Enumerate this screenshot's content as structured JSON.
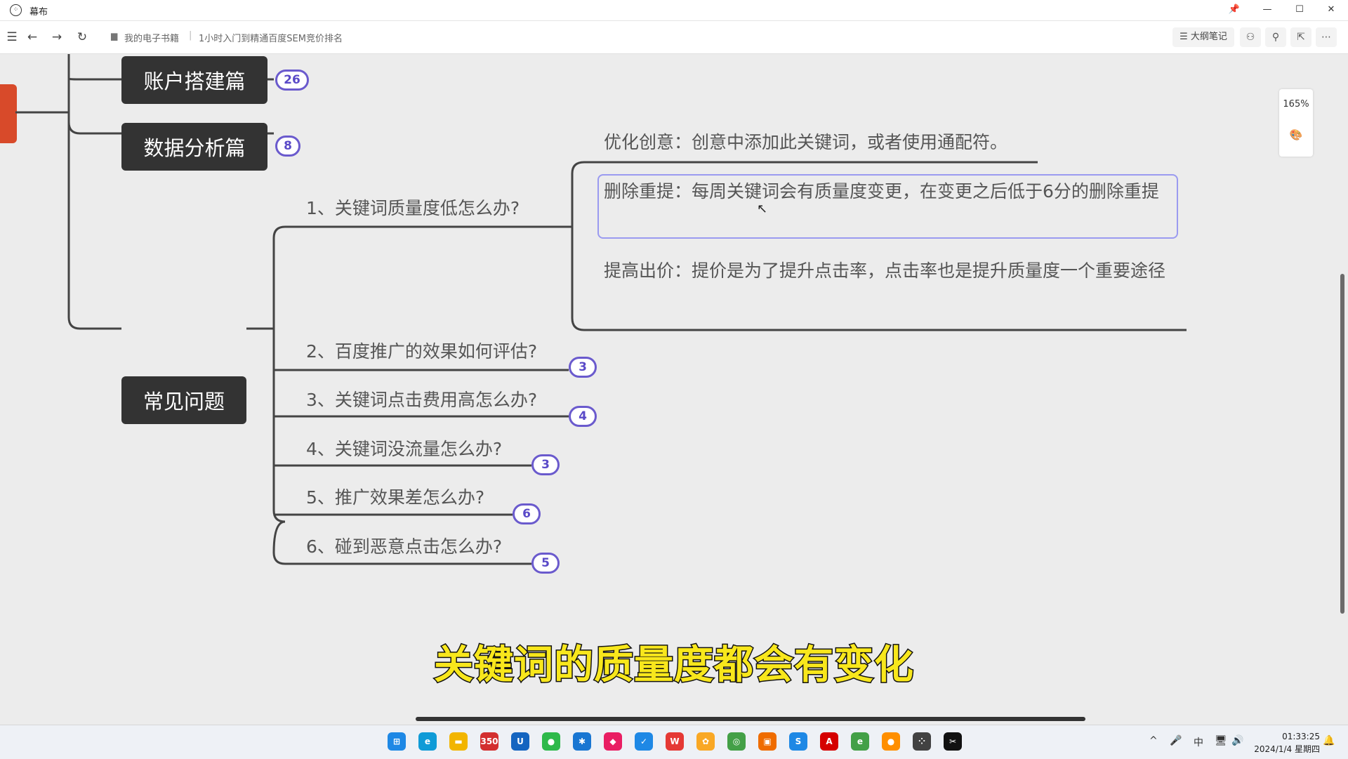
{
  "window": {
    "title": "幕布",
    "icon": "mubu-logo-icon"
  },
  "window_controls": {
    "pin": "📌",
    "minimize": "—",
    "maximize": "☐",
    "close": "✕"
  },
  "toolbar": {
    "menu_icon": "☰",
    "back_icon": "←",
    "forward_icon": "→",
    "refresh_icon": "↻",
    "folder_icon": "▆",
    "breadcrumb_folder": "我的电子书籍",
    "breadcrumb_sep": "|",
    "breadcrumb_doc": "1小时入门到精通百度SEM竞价排名",
    "outline_label": "☰ 大纲笔记",
    "mindmap_icon": "⚇",
    "share_icon": "⚲",
    "export_icon": "⇱",
    "more_icon": "⋯"
  },
  "mindmap": {
    "branches": [
      {
        "label": "账户搭建篇",
        "count": "26"
      },
      {
        "label": "数据分析篇",
        "count": "8"
      },
      {
        "label": "常见问题"
      }
    ],
    "questions": [
      {
        "label": "1、关键词质量度低怎么办?"
      },
      {
        "label": "2、百度推广的效果如何评估?",
        "count": "3"
      },
      {
        "label": "3、关键词点击费用高怎么办?",
        "count": "4"
      },
      {
        "label": "4、关键词没流量怎么办?",
        "count": "3"
      },
      {
        "label": "5、推广效果差怎么办?",
        "count": "6"
      },
      {
        "label": "6、碰到恶意点击怎么办?",
        "count": "5"
      }
    ],
    "answers": [
      "优化创意：创意中添加此关键词，或者使用通配符。",
      "删除重提：每周关键词会有质量度变更，在变更之后低于6分的删除重提",
      "提高出价：提价是为了提升点击率，点击率也是提升质量度一个重要途径"
    ]
  },
  "zoom": {
    "level": "165%",
    "palette_icon": "🎨"
  },
  "subtitle": "关键词的质量度都会有变化",
  "taskbar": {
    "apps": [
      {
        "name": "start",
        "glyph": "⊞",
        "color": "#1e88e5"
      },
      {
        "name": "edge",
        "glyph": "e",
        "color": "#0f9bd7"
      },
      {
        "name": "explorer",
        "glyph": "▬",
        "color": "#f2b500"
      },
      {
        "name": "app-350",
        "glyph": "350",
        "color": "#d32f2f"
      },
      {
        "name": "app-blue-u",
        "glyph": "U",
        "color": "#1565c0"
      },
      {
        "name": "wechat",
        "glyph": "●",
        "color": "#2eb94a"
      },
      {
        "name": "app-star",
        "glyph": "✱",
        "color": "#1976d2"
      },
      {
        "name": "app-pink",
        "glyph": "◆",
        "color": "#e91e63"
      },
      {
        "name": "app-blue-bird",
        "glyph": "✓",
        "color": "#1e88e5"
      },
      {
        "name": "wps",
        "glyph": "W",
        "color": "#e53935"
      },
      {
        "name": "app-yellow",
        "glyph": "✿",
        "color": "#f9a825"
      },
      {
        "name": "app-green-circle",
        "glyph": "◎",
        "color": "#43a047"
      },
      {
        "name": "app-photo",
        "glyph": "▣",
        "color": "#ef6c00"
      },
      {
        "name": "app-blue-swirl",
        "glyph": "S",
        "color": "#1e88e5"
      },
      {
        "name": "acrobat",
        "glyph": "A",
        "color": "#d50000"
      },
      {
        "name": "app-green-e",
        "glyph": "e",
        "color": "#43a047"
      },
      {
        "name": "app-orange-ball",
        "glyph": "●",
        "color": "#ff8f00"
      },
      {
        "name": "mubu",
        "glyph": "⁘",
        "color": "#424242"
      },
      {
        "name": "capcut",
        "glyph": "✂",
        "color": "#111111"
      }
    ],
    "tray": {
      "chevron": "^",
      "mic": "🎤",
      "ime": "中",
      "network": "🖥",
      "volume": "🔊",
      "bell": "🔔"
    },
    "time": "01:33:25",
    "date": "2024/1/4 星期四"
  }
}
